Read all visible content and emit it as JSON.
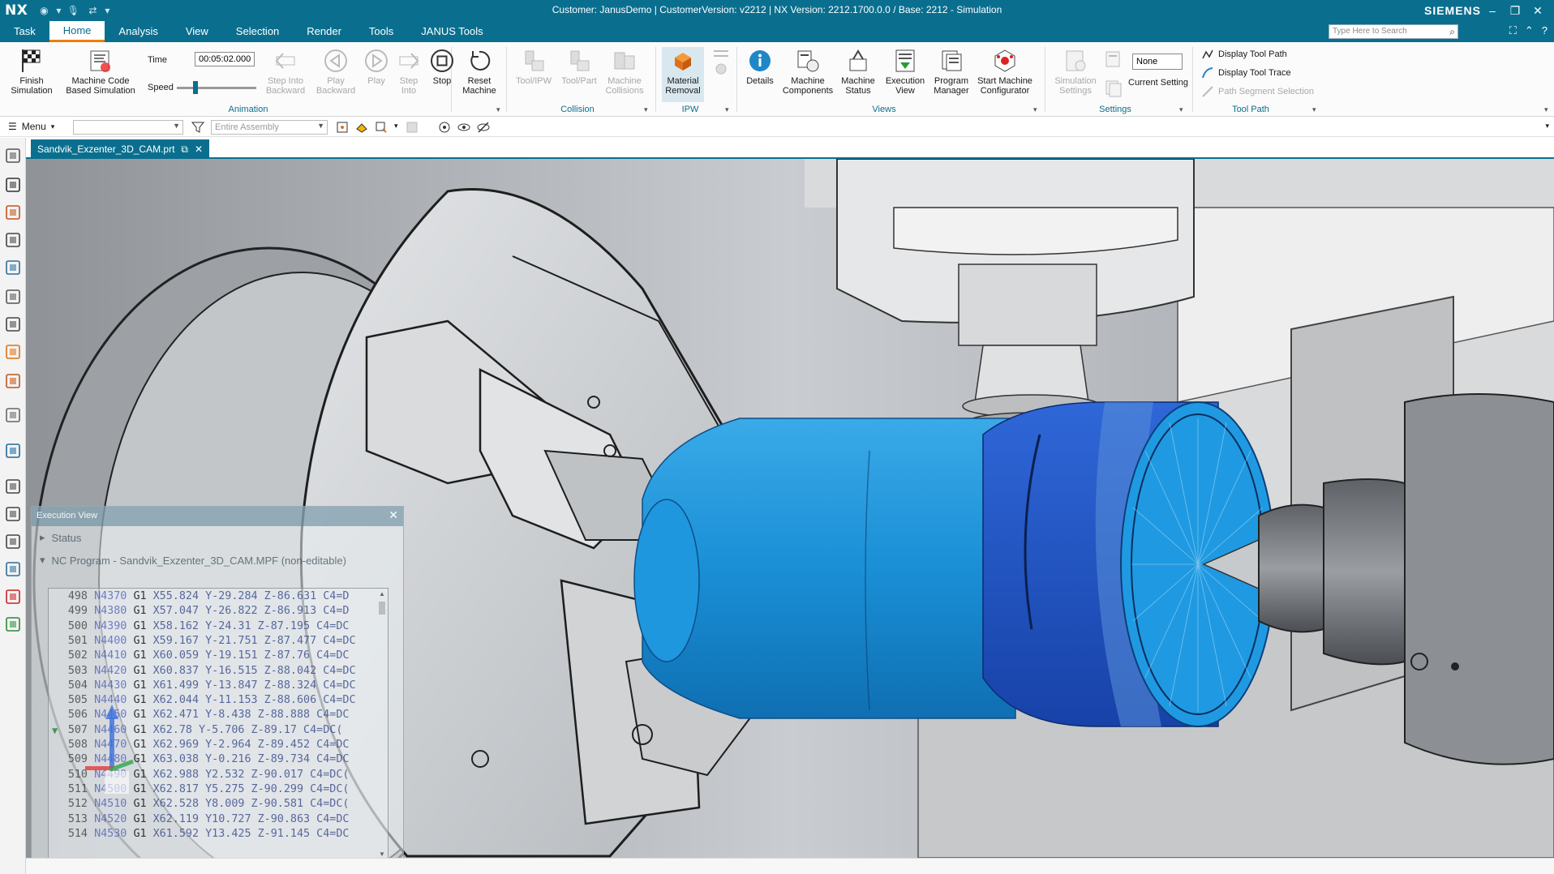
{
  "title_bar": {
    "app_logo": "NX",
    "title": "Customer: JanusDemo | CustomerVersion: v2212 | NX Version: 2212.1700.0.0 / Base: 2212 - Simulation",
    "brand": "SIEMENS",
    "icons": [
      "record-icon",
      "mic-icon",
      "touch-mode-icon"
    ]
  },
  "menu": {
    "tabs": [
      "Task",
      "Home",
      "Analysis",
      "View",
      "Selection",
      "Render",
      "Tools",
      "JANUS Tools"
    ],
    "active_tab": "Home",
    "search_placeholder": "Type Here to Search"
  },
  "ribbon": {
    "finish_simulation": "Finish Simulation",
    "machine_code": "Machine Code Based Simulation",
    "time_label": "Time",
    "time_value": "00:05:02.000",
    "speed_label": "Speed",
    "speed_level": 0.2,
    "step_into_backward": "Step Into Backward",
    "play_backward": "Play Backward",
    "play": "Play",
    "step_into": "Step Into",
    "stop": "Stop",
    "reset_machine": "Reset Machine",
    "animation_group": "Animation",
    "tool_ipw": "Tool/IPW",
    "tool_part": "Tool/Part",
    "machine_collisions": "Machine Collisions",
    "collision_group": "Collision",
    "material_removal": "Material Removal",
    "ipw_group": "IPW",
    "details": "Details",
    "machine_components": "Machine Components",
    "machine_status": "Machine Status",
    "execution_view": "Execution View",
    "program_manager": "Program Manager",
    "start_machine_configurator": "Start Machine Configurator",
    "views_group": "Views",
    "simulation_settings": "Simulation Settings",
    "current_setting_value": "None",
    "current_setting": "Current Setting",
    "settings_group": "Settings",
    "display_tool_path": "Display Tool Path",
    "display_tool_trace": "Display Tool Trace",
    "path_segment_selection": "Path Segment Selection",
    "tool_path_group": "Tool Path"
  },
  "toolbar2": {
    "menu_label": "Menu",
    "filter_combo": "",
    "scope_combo": "Entire Assembly"
  },
  "document_tab": {
    "label": "Sandvik_Exzenter_3D_CAM.prt"
  },
  "execution_view": {
    "title": "Execution View",
    "status_label": "Status",
    "nc_program_label": "NC Program - Sandvik_Exzenter_3D_CAM.MPF (non-editable)",
    "lines": [
      {
        "ln": "498",
        "n": "N4370",
        "g": "G1",
        "rest": "X55.824 Y-29.284 Z-86.631 C4=D"
      },
      {
        "ln": "499",
        "n": "N4380",
        "g": "G1",
        "rest": "X57.047 Y-26.822 Z-86.913 C4=D"
      },
      {
        "ln": "500",
        "n": "N4390",
        "g": "G1",
        "rest": "X58.162 Y-24.31 Z-87.195 C4=DC"
      },
      {
        "ln": "501",
        "n": "N4400",
        "g": "G1",
        "rest": "X59.167 Y-21.751 Z-87.477 C4=DC"
      },
      {
        "ln": "502",
        "n": "N4410",
        "g": "G1",
        "rest": "X60.059 Y-19.151 Z-87.76 C4=DC"
      },
      {
        "ln": "503",
        "n": "N4420",
        "g": "G1",
        "rest": "X60.837 Y-16.515 Z-88.042 C4=DC"
      },
      {
        "ln": "504",
        "n": "N4430",
        "g": "G1",
        "rest": "X61.499 Y-13.847 Z-88.324 C4=DC"
      },
      {
        "ln": "505",
        "n": "N4440",
        "g": "G1",
        "rest": "X62.044 Y-11.153 Z-88.606 C4=DC"
      },
      {
        "ln": "506",
        "n": "N4450",
        "g": "G1",
        "rest": "X62.471 Y-8.438 Z-88.888 C4=DC"
      },
      {
        "ln": "507",
        "n": "N4460",
        "g": "G1",
        "rest": "X62.78 Y-5.706 Z-89.17 C4=DC("
      },
      {
        "ln": "508",
        "n": "N4470",
        "g": "G1",
        "rest": "X62.969 Y-2.964 Z-89.452 C4=DC"
      },
      {
        "ln": "509",
        "n": "N4480",
        "g": "G1",
        "rest": "X63.038 Y-0.216 Z-89.734 C4=DC"
      },
      {
        "ln": "510",
        "n": "N4490",
        "g": "G1",
        "rest": "X62.988 Y2.532 Z-90.017 C4=DC("
      },
      {
        "ln": "511",
        "n": "N4500",
        "g": "G1",
        "rest": "X62.817 Y5.275 Z-90.299 C4=DC("
      },
      {
        "ln": "512",
        "n": "N4510",
        "g": "G1",
        "rest": "X62.528 Y8.009 Z-90.581 C4=DC("
      },
      {
        "ln": "513",
        "n": "N4520",
        "g": "G1",
        "rest": "X62.119 Y10.727 Z-90.863 C4=DC"
      },
      {
        "ln": "514",
        "n": "N4530",
        "g": "G1",
        "rest": "X61.592 Y13.425 Z-91.145 C4=DC"
      }
    ],
    "current_line": "507"
  },
  "colors": {
    "accent": "#0a6f8f",
    "active_tab_underline": "#f07d00",
    "workpiece": "#1a8fd6",
    "workpiece_dark": "#1b55c4"
  }
}
